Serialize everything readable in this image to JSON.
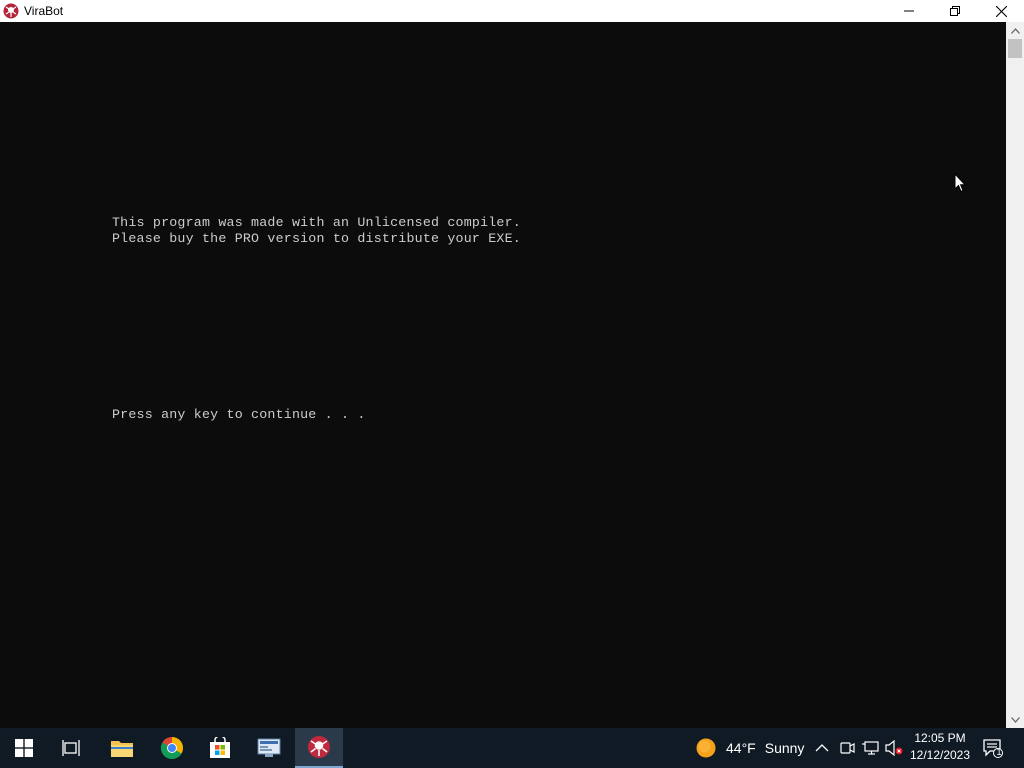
{
  "window": {
    "title": "ViraBot"
  },
  "console": {
    "lines": [
      "This program was made with an Unlicensed compiler.",
      "Please buy the PRO version to distribute your EXE.",
      "Press any key to continue . . ."
    ]
  },
  "taskbar": {
    "apps": [
      "start-icon",
      "task-view-icon",
      "file-explorer-icon",
      "chrome-icon",
      "microsoft-store-icon",
      "control-panel-icon",
      "virabot-icon"
    ],
    "weather": {
      "temperature": "44°F",
      "condition": "Sunny"
    },
    "clock": {
      "time": "12:05 PM",
      "date": "12/12/2023"
    },
    "notification_count": "1"
  },
  "colors": {
    "console_bg": "#0c0c0c",
    "console_text": "#cccccc",
    "taskbar_bg": "#101a24"
  }
}
